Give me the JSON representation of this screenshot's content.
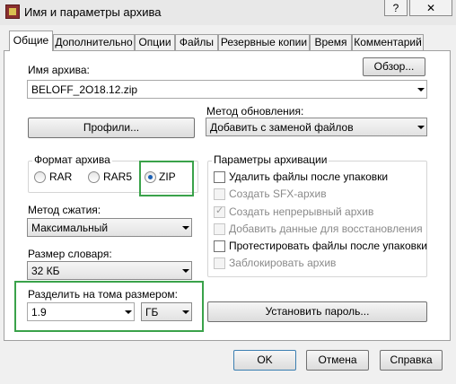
{
  "window": {
    "title": "Имя и параметры архива",
    "help_label": "?",
    "close_label": "✕"
  },
  "tabs": [
    {
      "label": "Общие",
      "active": true
    },
    {
      "label": "Дополнительно"
    },
    {
      "label": "Опции"
    },
    {
      "label": "Файлы"
    },
    {
      "label": "Резервные копии"
    },
    {
      "label": "Время"
    },
    {
      "label": "Комментарий"
    }
  ],
  "archive_name": {
    "label": "Имя архива:",
    "browse_label": "Обзор...",
    "value": "BELOFF_2O18.12.zip"
  },
  "profiles_label": "Профили...",
  "update_method": {
    "label": "Метод обновления:",
    "value": "Добавить с заменой файлов"
  },
  "format": {
    "label": "Формат архива",
    "options": [
      {
        "label": "RAR",
        "checked": false
      },
      {
        "label": "RAR5",
        "checked": false
      },
      {
        "label": "ZIP",
        "checked": true
      }
    ]
  },
  "params": {
    "label": "Параметры архивации",
    "items": [
      {
        "label": "Удалить файлы после упаковки",
        "checked": false,
        "enabled": true
      },
      {
        "label": "Создать SFX-архив",
        "checked": false,
        "enabled": false
      },
      {
        "label": "Создать непрерывный архив",
        "checked": true,
        "enabled": false
      },
      {
        "label": "Добавить данные для восстановления",
        "checked": false,
        "enabled": false
      },
      {
        "label": "Протестировать файлы после упаковки",
        "checked": false,
        "enabled": true
      },
      {
        "label": "Заблокировать архив",
        "checked": false,
        "enabled": false
      }
    ]
  },
  "compression": {
    "label": "Метод сжатия:",
    "value": "Максимальный"
  },
  "dictionary": {
    "label": "Размер словаря:",
    "value": "32 КБ"
  },
  "split": {
    "label": "Разделить на тома размером:",
    "value": "1.9",
    "unit": "ГБ"
  },
  "password_label": "Установить пароль...",
  "footer": {
    "ok": "OK",
    "cancel": "Отмена",
    "help": "Справка"
  },
  "colors": {
    "highlight": "#3aa24a"
  }
}
